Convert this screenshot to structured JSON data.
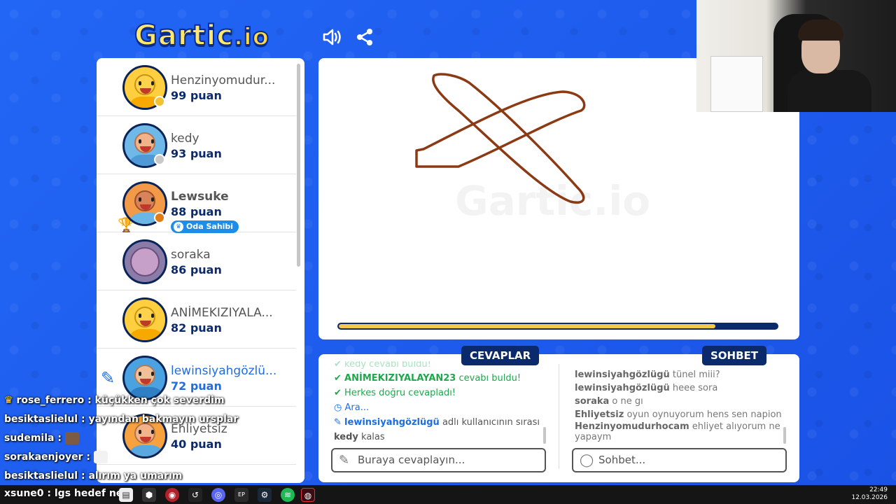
{
  "header": {
    "logo_main": "Gartic",
    "logo_sub": ".io",
    "sound_icon": "speaker-icon",
    "share_icon": "share-icon"
  },
  "players": [
    {
      "name": "Henzinyomudur...",
      "points": "99 puan",
      "status_color": "#f2c230",
      "avatar_color": "#ffcf3f"
    },
    {
      "name": "kedy",
      "points": "93 puan",
      "status_color": "#c9c9c9",
      "avatar_color": "#6fb8e8"
    },
    {
      "name": "Lewsuke",
      "points": "88 puan",
      "status_color": "#e07b16",
      "avatar_color": "#f39a49",
      "host_label": "Oda Sahibi"
    },
    {
      "name": "soraka",
      "points": "86 puan",
      "avatar_color": "#8a7ca8"
    },
    {
      "name": "ANİMEKIZIYALA...",
      "points": "82 puan",
      "avatar_color": "#ffcf3f"
    },
    {
      "name": "lewinsiyahgözlü...",
      "points": "72 puan",
      "avatar_color": "#4aa3e0"
    },
    {
      "name": "Ehliyetsiz",
      "points": "40 puan",
      "avatar_color": "#f7a23e"
    }
  ],
  "canvas": {
    "watermark": "Gartic.io",
    "progress": 0.86
  },
  "tabs": {
    "answers": "CEVAPLAR",
    "chat": "SOHBET"
  },
  "answers": {
    "faded": "kedy cevabı buldu!",
    "row1_name": "ANİMEKIZIYALAYAN23",
    "row1_text": " cevabı buldu!",
    "row2": "Herkes doğru cevapladı!",
    "row3": "Ara...",
    "row4_name": "lewinsiyahgözlügü",
    "row4_text": " adlı kullanıcının sırası",
    "row5_name": "kedy",
    "row5_text": " kalas",
    "placeholder": "Buraya cevaplayın..."
  },
  "chat": {
    "messages": [
      {
        "user": "lewinsiyahgözlügü",
        "text": " tünel miii?"
      },
      {
        "user": "lewinsiyahgözlügü",
        "text": " heee sora"
      },
      {
        "user": "soraka",
        "text": " o ne gı"
      },
      {
        "user": "Ehliyetsiz",
        "text": " oyun oynuyorum hens sen napion"
      },
      {
        "user": "Henzinyomudurhocam",
        "text": " ehliyet alıyorum ne yapaym"
      }
    ],
    "placeholder": "Sohbet..."
  },
  "stream_chat": [
    {
      "user": "rose_ferrero",
      "text": " : küçükken çok severdim",
      "color": "#ffffff"
    },
    {
      "user": "besiktaslielul",
      "text": " : yayından bakmayın ursplar",
      "color": "#ffffff"
    },
    {
      "user": "sudemila",
      "text": " :",
      "color": "#ffffff"
    },
    {
      "user": "sorakaenjoyer",
      "text": " :",
      "color": "#ffffff"
    },
    {
      "user": "besiktaslielul",
      "text": " : alırım ya umarım",
      "color": "#ffffff"
    }
  ],
  "taskbar": {
    "chat_line": "xsune0 : lgs hedef ne",
    "time": "22:49",
    "date": "12.03.2026"
  }
}
